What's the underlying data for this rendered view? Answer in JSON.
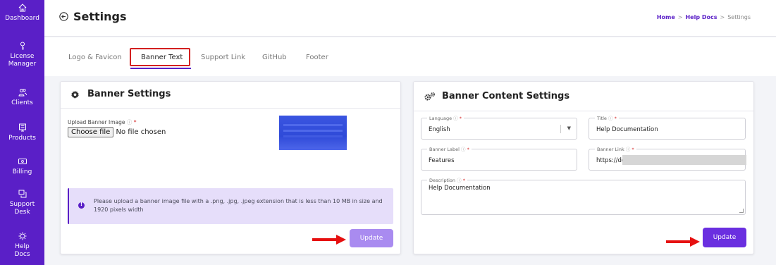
{
  "sidebar": {
    "items": [
      {
        "label_lines": [
          "Dashboard"
        ],
        "icon": "home-icon"
      },
      {
        "label_lines": [
          "License",
          "Manager"
        ],
        "icon": "key-icon"
      },
      {
        "label_lines": [
          "Clients"
        ],
        "icon": "users-icon"
      },
      {
        "label_lines": [
          "Products"
        ],
        "icon": "products-icon"
      },
      {
        "label_lines": [
          "Billing"
        ],
        "icon": "billing-icon"
      },
      {
        "label_lines": [
          "Support",
          "Desk"
        ],
        "icon": "support-icon"
      },
      {
        "label_lines": [
          "Help",
          "Docs"
        ],
        "icon": "help-docs-icon"
      }
    ]
  },
  "header": {
    "title": "Settings",
    "breadcrumb": [
      "Home",
      "Help Docs",
      "Settings"
    ],
    "breadcrumb_separator": ">"
  },
  "tabs": [
    {
      "label": "Logo & Favicon",
      "active": false
    },
    {
      "label": "Banner Text",
      "active": true
    },
    {
      "label": "Support Link",
      "active": false
    },
    {
      "label": "GitHub",
      "active": false
    },
    {
      "label": "Footer",
      "active": false
    }
  ],
  "banner_settings": {
    "title": "Banner Settings",
    "upload_label": "Upload Banner Image",
    "help_mark": "ⓘ",
    "required_mark": "*",
    "file_button": "Choose file",
    "file_status": "No file chosen",
    "info_text": "Please upload a banner image file with a .png, .jpg, .jpeg extension that is less than 10 MB in size and 1920 pixels width",
    "update_label": "Update"
  },
  "banner_content": {
    "title": "Banner Content Settings",
    "language": {
      "label": "Language",
      "value": "English"
    },
    "title_field": {
      "label": "Title",
      "value": "Help Documentation"
    },
    "banner_label": {
      "label": "Banner Label",
      "value": "Features"
    },
    "banner_link": {
      "label": "Banner Link",
      "value": "https://dc"
    },
    "description": {
      "label": "Description",
      "value": "Help Documentation"
    },
    "update_label": "Update"
  },
  "colors": {
    "brand": "#5a1fc7",
    "update_disabled": "#a98bf0",
    "update_enabled": "#6a2fe0",
    "highlight_red": "#d32020",
    "info_bg": "#e6defa"
  }
}
